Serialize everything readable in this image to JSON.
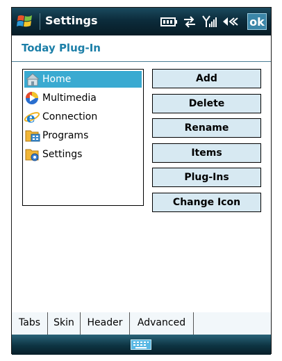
{
  "titlebar": {
    "title": "Settings",
    "ok_label": "ok",
    "status_icons": [
      "battery-icon",
      "connectivity-icon",
      "signal-icon",
      "volume-icon"
    ]
  },
  "page": {
    "heading": "Today Plug-In"
  },
  "tree": {
    "items": [
      {
        "label": "Home",
        "icon": "home-icon",
        "selected": true
      },
      {
        "label": "Multimedia",
        "icon": "media-player-icon",
        "selected": false
      },
      {
        "label": "Connection",
        "icon": "internet-explorer-icon",
        "selected": false
      },
      {
        "label": "Programs",
        "icon": "programs-folder-icon",
        "selected": false
      },
      {
        "label": "Settings",
        "icon": "settings-folder-icon",
        "selected": false
      }
    ]
  },
  "buttons": [
    "Add",
    "Delete",
    "Rename",
    "Items",
    "Plug-Ins",
    "Change Icon"
  ],
  "tabs": [
    {
      "label": "Tabs",
      "active": true
    },
    {
      "label": "Skin",
      "active": false
    },
    {
      "label": "Header",
      "active": false
    },
    {
      "label": "Advanced",
      "active": false
    }
  ],
  "bottombar": {
    "icon": "keyboard-icon"
  },
  "colors": {
    "accent": "#1c7fa8",
    "selection": "#3aaad1",
    "button": "#d7e9f2",
    "titlebar": "#0c2c3c"
  }
}
